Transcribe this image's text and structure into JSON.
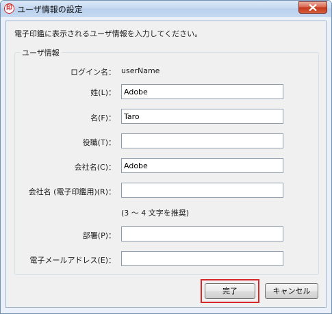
{
  "window": {
    "title": "ユーザ情報の設定",
    "app_icon_glyph": "印"
  },
  "intro_text": "電子印鑑に表示されるユーザ情報を入力してください。",
  "group": {
    "legend": "ユーザ情報",
    "login": {
      "label": "ログイン名：",
      "value": "userName"
    },
    "fields": {
      "last_name": {
        "label": "姓(L)：",
        "value": "Adobe"
      },
      "first_name": {
        "label": "名(F)：",
        "value": "Taro"
      },
      "title": {
        "label": "役職(T)：",
        "value": ""
      },
      "company": {
        "label": "会社名(C)：",
        "value": "Adobe"
      },
      "company_stamp": {
        "label": "会社名 (電子印鑑用)(R)：",
        "value": ""
      },
      "department": {
        "label": "部署(P)：",
        "value": ""
      },
      "email": {
        "label": "電子メールアドレス(E)：",
        "value": ""
      }
    },
    "stamp_hint": "(3 ～ 4 文字を推奨)"
  },
  "buttons": {
    "done": "完了",
    "cancel": "キャンセル"
  },
  "colors": {
    "highlight_border": "#d9262b",
    "close_button": "#c3381c"
  }
}
